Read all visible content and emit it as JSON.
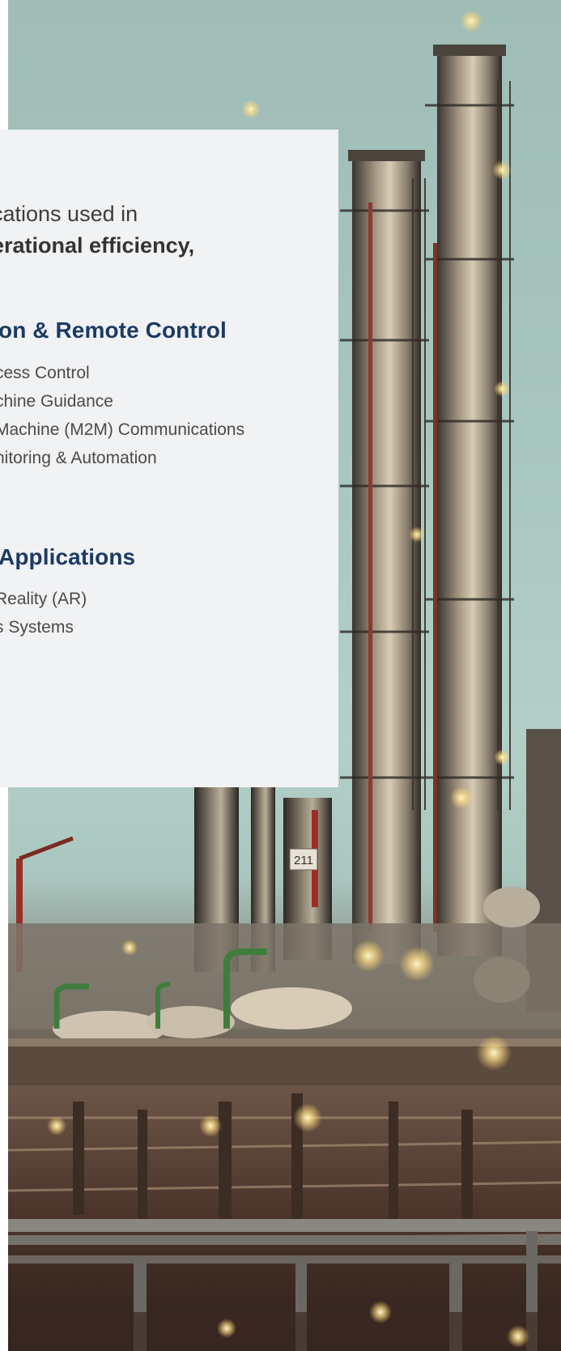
{
  "intro": {
    "line1": "cations used in",
    "line2": "erational efficiency,"
  },
  "sections": [
    {
      "title": "on & Remote Control",
      "items": [
        "cess Control",
        "chine Guidance",
        "Machine (M2M) Communications",
        "nitoring & Automation"
      ]
    },
    {
      "title": "Applications",
      "items": [
        "Reality (AR)",
        "s Systems"
      ]
    }
  ],
  "photo": {
    "tower_label": "211"
  },
  "colors": {
    "panel_bg": "#f1f2f4",
    "heading": "#1c3a63",
    "body_text": "#4a4a4a"
  }
}
